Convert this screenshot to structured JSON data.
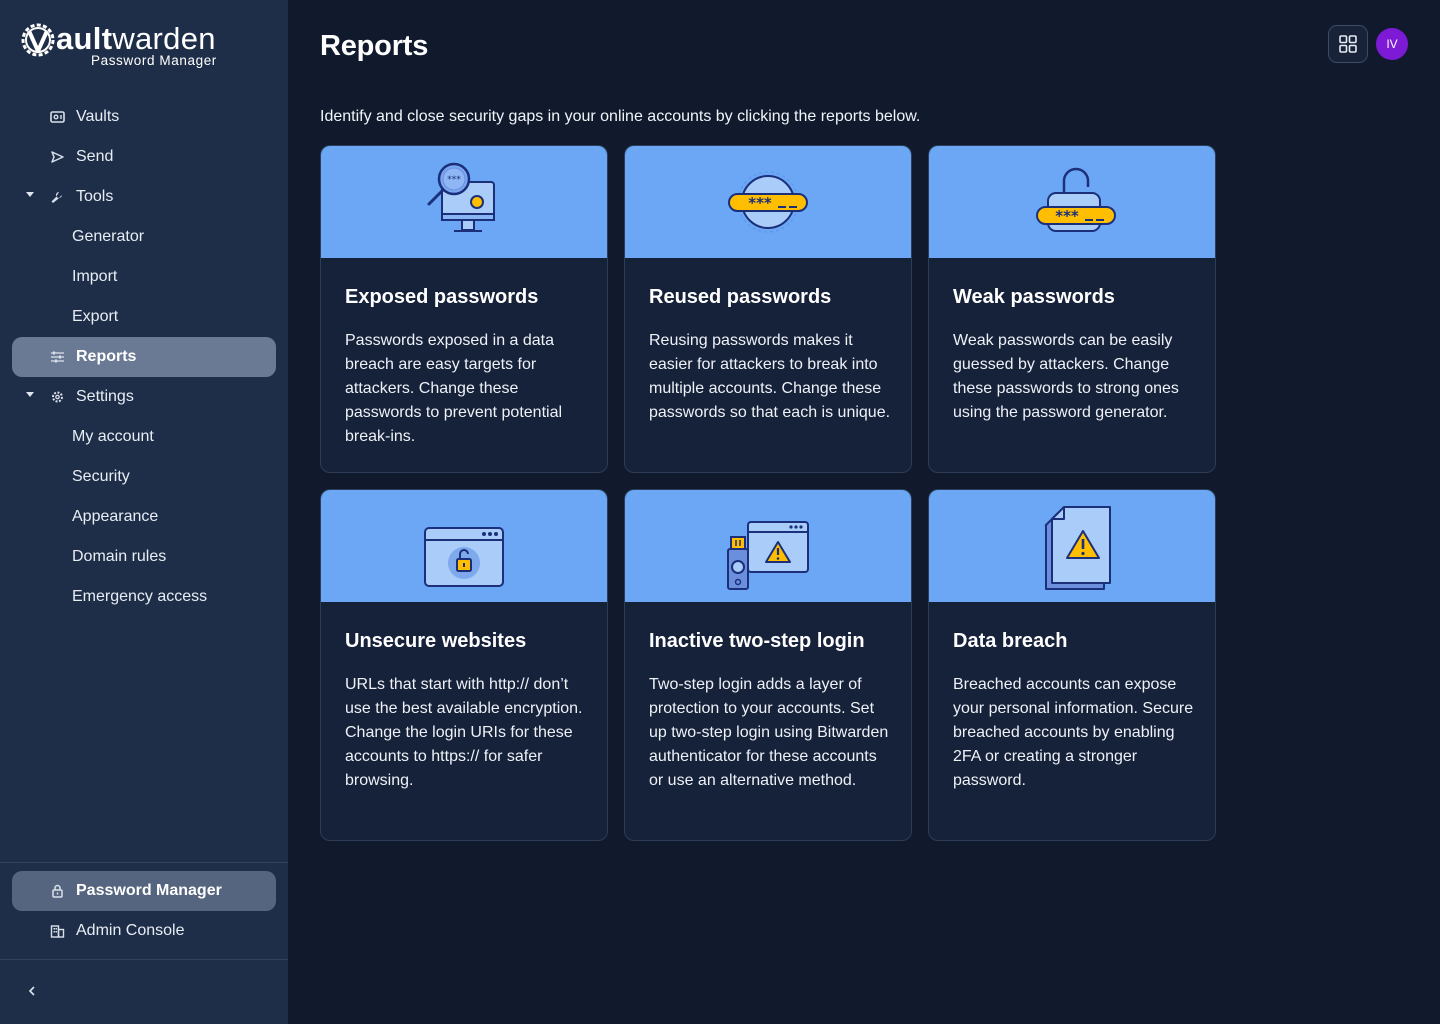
{
  "app": {
    "logo_brand_bold": "ault",
    "logo_brand_rest": "warden",
    "logo_sub": "Password Manager"
  },
  "sidebar": {
    "items": [
      {
        "label": "Vaults",
        "icon": "vault-icon"
      },
      {
        "label": "Send",
        "icon": "send-icon"
      },
      {
        "label": "Tools",
        "icon": "wrench-icon",
        "expanded": true
      },
      {
        "label": "Generator"
      },
      {
        "label": "Import"
      },
      {
        "label": "Export"
      },
      {
        "label": "Reports",
        "icon": "sliders-icon",
        "active": true
      },
      {
        "label": "Settings",
        "icon": "gear-icon",
        "expanded": true
      },
      {
        "label": "My account"
      },
      {
        "label": "Security"
      },
      {
        "label": "Appearance"
      },
      {
        "label": "Domain rules"
      },
      {
        "label": "Emergency access"
      }
    ],
    "products": [
      {
        "label": "Password Manager",
        "icon": "lock-icon",
        "active": true
      },
      {
        "label": "Admin Console",
        "icon": "building-icon"
      }
    ],
    "collapse_icon": "chevron-left-icon"
  },
  "header": {
    "title": "Reports",
    "avatar_initials": "IV",
    "grid_icon": "app-grid-icon"
  },
  "main": {
    "intro": "Identify and close security gaps in your online accounts by clicking the reports below.",
    "cards": [
      {
        "title": "Exposed passwords",
        "desc": "Passwords exposed in a data breach are easy targets for attackers. Change these passwords to prevent potential break-ins.",
        "icon": "monitor-magnifier-icon"
      },
      {
        "title": "Reused passwords",
        "desc": "Reusing passwords makes it easier for attackers to break into multiple accounts. Change these passwords so that each is unique.",
        "icon": "password-field-icon"
      },
      {
        "title": "Weak passwords",
        "desc": "Weak passwords can be easily guessed by attackers. Change these passwords to strong ones using the password generator.",
        "icon": "open-padlock-icon"
      },
      {
        "title": "Unsecure websites",
        "desc": "URLs that start with http:// don’t use the best available encryption. Change the login URIs for these accounts to https:// for safer browsing.",
        "icon": "browser-unlocked-icon"
      },
      {
        "title": "Inactive two-step login",
        "desc": "Two-step login adds a layer of protection to your accounts. Set up two-step login using Bitwarden authenticator for these accounts or use an alternative method.",
        "icon": "usb-key-warning-icon"
      },
      {
        "title": "Data breach",
        "desc": "Breached accounts can expose your personal information. Secure breached accounts by enabling 2FA or creating a stronger password.",
        "icon": "document-warning-icon"
      }
    ]
  },
  "colors": {
    "background": "#101a2c",
    "sidebar": "#1f2e48",
    "card_banner": "#6ba7f5",
    "accent_yellow": "#ffbf00",
    "avatar": "#7c1ad6"
  }
}
